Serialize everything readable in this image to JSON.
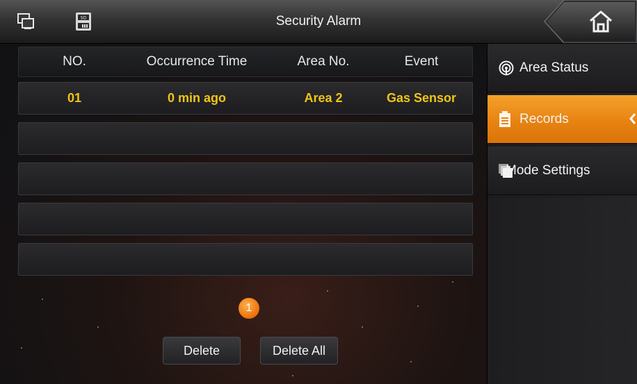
{
  "header": {
    "title": "Security Alarm",
    "icons": [
      "network-status-icon",
      "sd-card-icon",
      "home-icon"
    ]
  },
  "table": {
    "columns": [
      "NO.",
      "Occurrence Time",
      "Area No.",
      "Event"
    ],
    "rows": [
      {
        "no": "01",
        "time": "0 min ago",
        "area": "Area 2",
        "event": "Gas Sensor"
      }
    ],
    "empty_rows": 4,
    "highlight_color": "#f0c514"
  },
  "sidebar": {
    "items": [
      {
        "label": "Area Status",
        "icon": "area-status-icon",
        "active": false
      },
      {
        "label": "Records",
        "icon": "records-clipboard-icon",
        "active": true
      },
      {
        "label": "Mode Settings",
        "icon": "mode-settings-icon",
        "active": false
      }
    ],
    "active_color": "#ec8a16"
  },
  "pagination": {
    "current_page": "1"
  },
  "actions": {
    "delete_label": "Delete",
    "delete_all_label": "Delete All"
  }
}
